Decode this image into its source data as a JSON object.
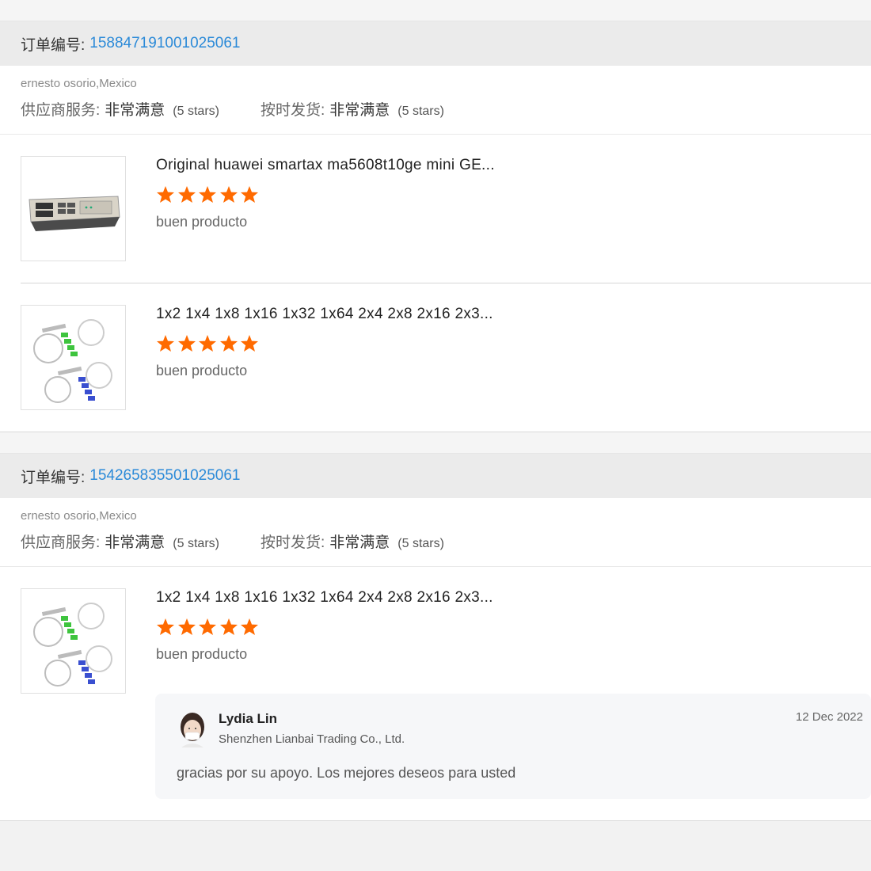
{
  "orders": [
    {
      "label": "订单编号:",
      "number": "158847191001025061",
      "buyer": "ernesto osorio,Mexico",
      "supplier_service": {
        "label": "供应商服务:",
        "value": "非常满意",
        "stars": "(5 stars)"
      },
      "on_time": {
        "label": "按时发货:",
        "value": "非常满意",
        "stars": "(5 stars)"
      },
      "items": [
        {
          "title": "Original huawei smartax ma5608t10ge mini GE...",
          "rating": 5,
          "comment": "buen producto",
          "image": "olt-device"
        },
        {
          "title": "1x2 1x4 1x8 1x16 1x32 1x64 2x4 2x8 2x16 2x3...",
          "rating": 5,
          "comment": "buen producto",
          "image": "fiber-splitter"
        }
      ]
    },
    {
      "label": "订单编号:",
      "number": "154265835501025061",
      "buyer": "ernesto osorio,Mexico",
      "supplier_service": {
        "label": "供应商服务:",
        "value": "非常满意",
        "stars": "(5 stars)"
      },
      "on_time": {
        "label": "按时发货:",
        "value": "非常满意",
        "stars": "(5 stars)"
      },
      "items": [
        {
          "title": "1x2 1x4 1x8 1x16 1x32 1x64 2x4 2x8 2x16 2x3...",
          "rating": 5,
          "comment": "buen producto",
          "image": "fiber-splitter"
        }
      ],
      "reply": {
        "name": "Lydia Lin",
        "company": "Shenzhen Lianbai Trading Co., Ltd.",
        "date": "12 Dec 2022",
        "text": "gracias por su apoyo. Los mejores deseos para usted"
      }
    }
  ],
  "colors": {
    "accent": "#2b8ad8",
    "star": "#ff6a00"
  }
}
